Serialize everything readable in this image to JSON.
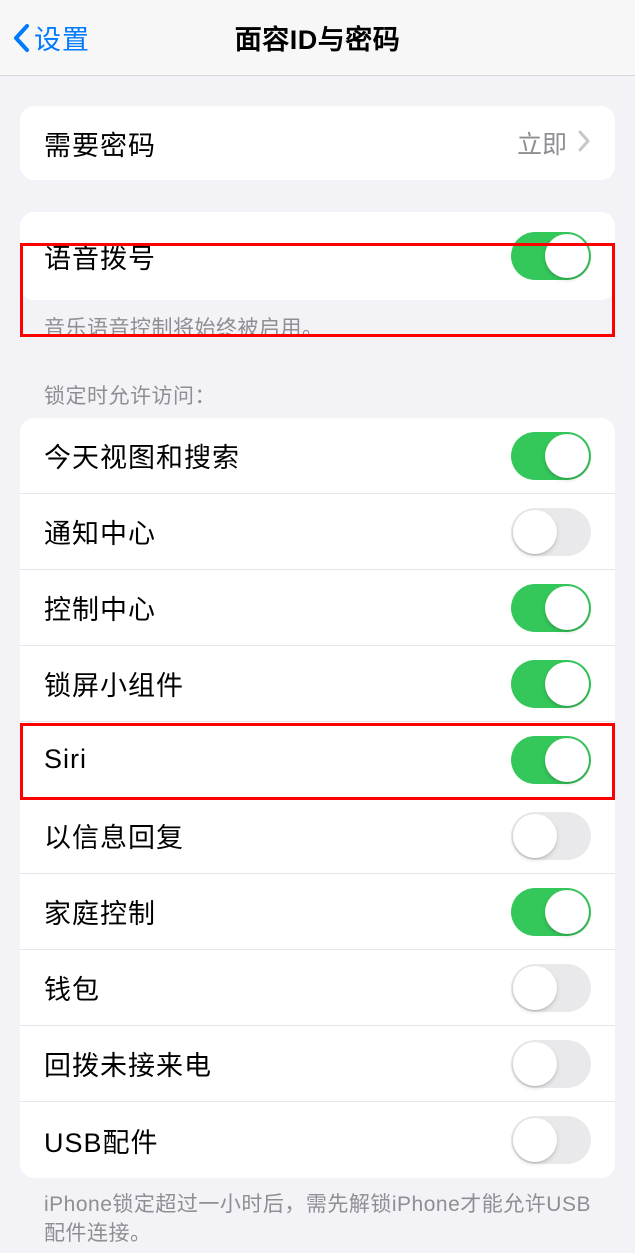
{
  "header": {
    "back_label": "设置",
    "title": "面容ID与密码"
  },
  "passcode_group": {
    "require_passcode": {
      "label": "需要密码",
      "value": "立即"
    }
  },
  "voice_dial": {
    "label": "语音拨号",
    "enabled": true,
    "footer": "音乐语音控制将始终被启用。"
  },
  "lock_access": {
    "header": "锁定时允许访问：",
    "items": [
      {
        "label": "今天视图和搜索",
        "enabled": true
      },
      {
        "label": "通知中心",
        "enabled": false
      },
      {
        "label": "控制中心",
        "enabled": true
      },
      {
        "label": "锁屏小组件",
        "enabled": true
      },
      {
        "label": "Siri",
        "enabled": true
      },
      {
        "label": "以信息回复",
        "enabled": false
      },
      {
        "label": "家庭控制",
        "enabled": true
      },
      {
        "label": "钱包",
        "enabled": false
      },
      {
        "label": "回拨未接来电",
        "enabled": false
      },
      {
        "label": "USB配件",
        "enabled": false
      }
    ],
    "footer": "iPhone锁定超过一小时后，需先解锁iPhone才能允许USB配件连接。"
  }
}
